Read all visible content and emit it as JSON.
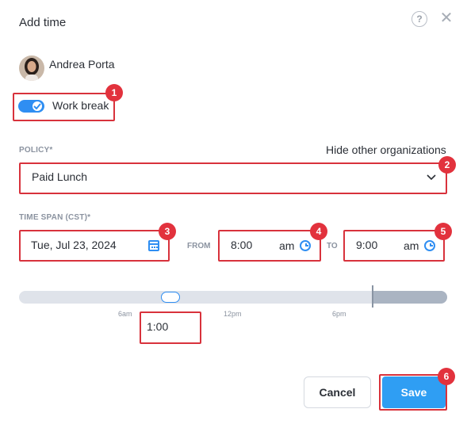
{
  "dialog": {
    "title": "Add time",
    "help_glyph": "?",
    "close_glyph": "✕"
  },
  "user": {
    "name": "Andrea Porta"
  },
  "work_break": {
    "label": "Work break",
    "enabled": true
  },
  "policy": {
    "label": "POLICY*",
    "hide_link": "Hide other organizations",
    "value": "Paid Lunch",
    "chevron": "⌄"
  },
  "time_span": {
    "label": "TIME SPAN (CST)*",
    "date": "Tue, Jul 23, 2024",
    "from_label": "FROM",
    "from_time": "8:00",
    "from_ampm": "am",
    "to_label": "TO",
    "to_time": "9:00",
    "to_ampm": "am"
  },
  "timeline": {
    "ticks": [
      "6am",
      "12pm",
      "6pm"
    ],
    "duration": "1:00"
  },
  "buttons": {
    "cancel": "Cancel",
    "save": "Save"
  },
  "annotations": [
    "1",
    "2",
    "3",
    "4",
    "5",
    "6"
  ],
  "colors": {
    "accent": "#2f8ef2",
    "save": "#2f9ef3",
    "highlight": "#d8323c"
  }
}
